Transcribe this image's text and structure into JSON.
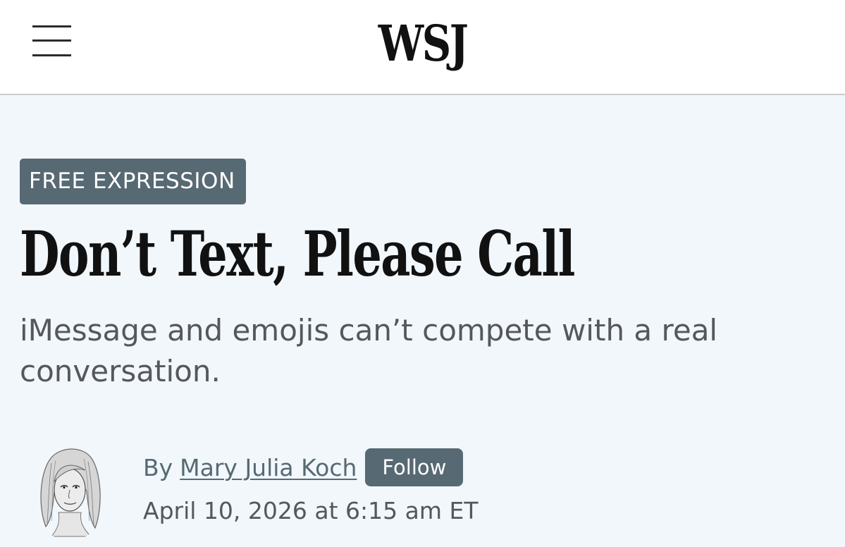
{
  "header": {
    "logo_text": "WSJ",
    "menu_icon": "hamburger-menu-icon"
  },
  "article": {
    "section_tag": "FREE EXPRESSION",
    "headline": "Don’t Text, Please Call",
    "dek": "iMessage and emojis can’t compete with a real conversation.",
    "byline_prefix": "By",
    "author": "Mary Julia Koch",
    "follow_label": "Follow",
    "timestamp": "April 10, 2026 at 6:15 am ET"
  },
  "colors": {
    "page_background": "#f1f7fb",
    "header_background": "#ffffff",
    "tag_background": "#576973",
    "byline_color": "#576973",
    "headline_color": "#111111",
    "dek_color": "#55575b"
  }
}
